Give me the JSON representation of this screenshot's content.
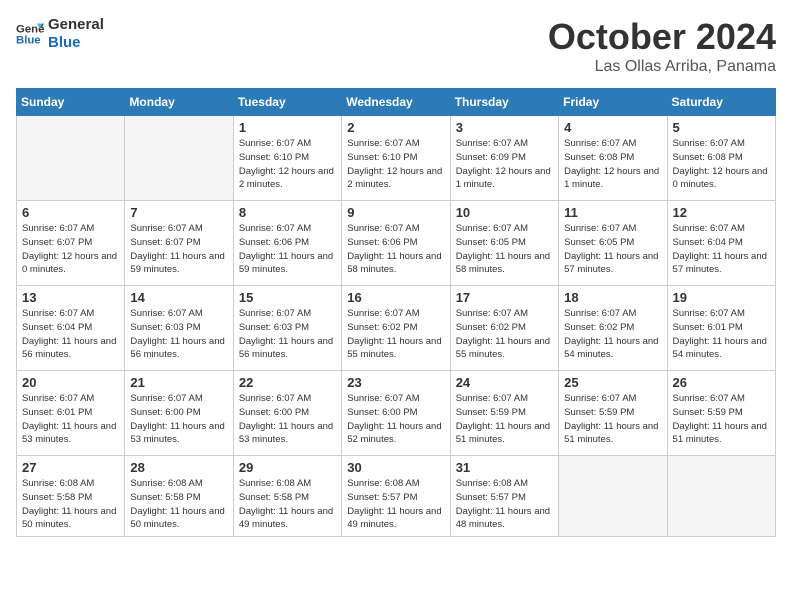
{
  "header": {
    "logo_line1": "General",
    "logo_line2": "Blue",
    "title": "October 2024",
    "subtitle": "Las Ollas Arriba, Panama"
  },
  "columns": [
    "Sunday",
    "Monday",
    "Tuesday",
    "Wednesday",
    "Thursday",
    "Friday",
    "Saturday"
  ],
  "weeks": [
    [
      {
        "day": "",
        "info": ""
      },
      {
        "day": "",
        "info": ""
      },
      {
        "day": "1",
        "info": "Sunrise: 6:07 AM\nSunset: 6:10 PM\nDaylight: 12 hours\nand 2 minutes."
      },
      {
        "day": "2",
        "info": "Sunrise: 6:07 AM\nSunset: 6:10 PM\nDaylight: 12 hours\nand 2 minutes."
      },
      {
        "day": "3",
        "info": "Sunrise: 6:07 AM\nSunset: 6:09 PM\nDaylight: 12 hours\nand 1 minute."
      },
      {
        "day": "4",
        "info": "Sunrise: 6:07 AM\nSunset: 6:08 PM\nDaylight: 12 hours\nand 1 minute."
      },
      {
        "day": "5",
        "info": "Sunrise: 6:07 AM\nSunset: 6:08 PM\nDaylight: 12 hours\nand 0 minutes."
      }
    ],
    [
      {
        "day": "6",
        "info": "Sunrise: 6:07 AM\nSunset: 6:07 PM\nDaylight: 12 hours\nand 0 minutes."
      },
      {
        "day": "7",
        "info": "Sunrise: 6:07 AM\nSunset: 6:07 PM\nDaylight: 11 hours\nand 59 minutes."
      },
      {
        "day": "8",
        "info": "Sunrise: 6:07 AM\nSunset: 6:06 PM\nDaylight: 11 hours\nand 59 minutes."
      },
      {
        "day": "9",
        "info": "Sunrise: 6:07 AM\nSunset: 6:06 PM\nDaylight: 11 hours\nand 58 minutes."
      },
      {
        "day": "10",
        "info": "Sunrise: 6:07 AM\nSunset: 6:05 PM\nDaylight: 11 hours\nand 58 minutes."
      },
      {
        "day": "11",
        "info": "Sunrise: 6:07 AM\nSunset: 6:05 PM\nDaylight: 11 hours\nand 57 minutes."
      },
      {
        "day": "12",
        "info": "Sunrise: 6:07 AM\nSunset: 6:04 PM\nDaylight: 11 hours\nand 57 minutes."
      }
    ],
    [
      {
        "day": "13",
        "info": "Sunrise: 6:07 AM\nSunset: 6:04 PM\nDaylight: 11 hours\nand 56 minutes."
      },
      {
        "day": "14",
        "info": "Sunrise: 6:07 AM\nSunset: 6:03 PM\nDaylight: 11 hours\nand 56 minutes."
      },
      {
        "day": "15",
        "info": "Sunrise: 6:07 AM\nSunset: 6:03 PM\nDaylight: 11 hours\nand 56 minutes."
      },
      {
        "day": "16",
        "info": "Sunrise: 6:07 AM\nSunset: 6:02 PM\nDaylight: 11 hours\nand 55 minutes."
      },
      {
        "day": "17",
        "info": "Sunrise: 6:07 AM\nSunset: 6:02 PM\nDaylight: 11 hours\nand 55 minutes."
      },
      {
        "day": "18",
        "info": "Sunrise: 6:07 AM\nSunset: 6:02 PM\nDaylight: 11 hours\nand 54 minutes."
      },
      {
        "day": "19",
        "info": "Sunrise: 6:07 AM\nSunset: 6:01 PM\nDaylight: 11 hours\nand 54 minutes."
      }
    ],
    [
      {
        "day": "20",
        "info": "Sunrise: 6:07 AM\nSunset: 6:01 PM\nDaylight: 11 hours\nand 53 minutes."
      },
      {
        "day": "21",
        "info": "Sunrise: 6:07 AM\nSunset: 6:00 PM\nDaylight: 11 hours\nand 53 minutes."
      },
      {
        "day": "22",
        "info": "Sunrise: 6:07 AM\nSunset: 6:00 PM\nDaylight: 11 hours\nand 53 minutes."
      },
      {
        "day": "23",
        "info": "Sunrise: 6:07 AM\nSunset: 6:00 PM\nDaylight: 11 hours\nand 52 minutes."
      },
      {
        "day": "24",
        "info": "Sunrise: 6:07 AM\nSunset: 5:59 PM\nDaylight: 11 hours\nand 51 minutes."
      },
      {
        "day": "25",
        "info": "Sunrise: 6:07 AM\nSunset: 5:59 PM\nDaylight: 11 hours\nand 51 minutes."
      },
      {
        "day": "26",
        "info": "Sunrise: 6:07 AM\nSunset: 5:59 PM\nDaylight: 11 hours\nand 51 minutes."
      }
    ],
    [
      {
        "day": "27",
        "info": "Sunrise: 6:08 AM\nSunset: 5:58 PM\nDaylight: 11 hours\nand 50 minutes."
      },
      {
        "day": "28",
        "info": "Sunrise: 6:08 AM\nSunset: 5:58 PM\nDaylight: 11 hours\nand 50 minutes."
      },
      {
        "day": "29",
        "info": "Sunrise: 6:08 AM\nSunset: 5:58 PM\nDaylight: 11 hours\nand 49 minutes."
      },
      {
        "day": "30",
        "info": "Sunrise: 6:08 AM\nSunset: 5:57 PM\nDaylight: 11 hours\nand 49 minutes."
      },
      {
        "day": "31",
        "info": "Sunrise: 6:08 AM\nSunset: 5:57 PM\nDaylight: 11 hours\nand 48 minutes."
      },
      {
        "day": "",
        "info": ""
      },
      {
        "day": "",
        "info": ""
      }
    ]
  ]
}
